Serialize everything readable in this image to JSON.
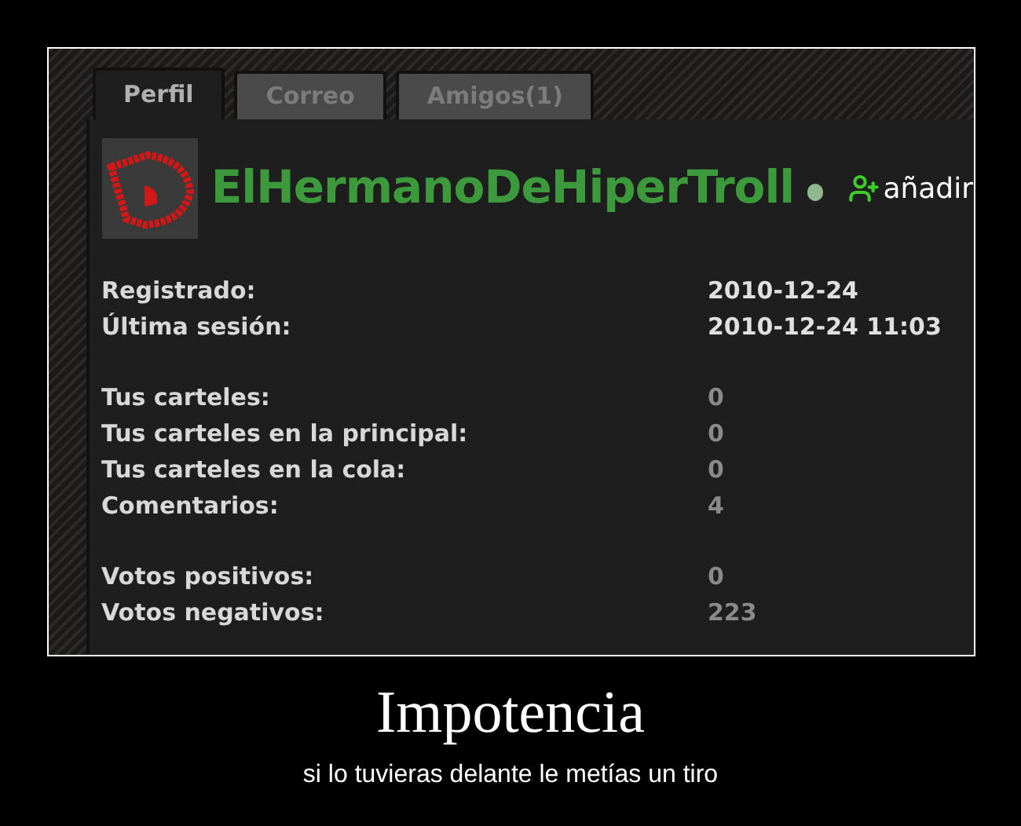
{
  "profile": {
    "tabs": [
      {
        "label": "Perfil",
        "selected": true
      },
      {
        "label": "Correo",
        "selected": false
      },
      {
        "label": "Amigos(1)",
        "selected": false
      }
    ],
    "user": {
      "name": "ElHermanoDeHiperTroll",
      "online": true,
      "add_link": "añadir"
    },
    "stat_groups": [
      [
        {
          "label": "Registrado:",
          "value": "2010-12-24",
          "kind": "date"
        },
        {
          "label": "Última sesión:",
          "value": "2010-12-24 11:03",
          "kind": "date"
        }
      ],
      [
        {
          "label": "Tus carteles:",
          "value": "0",
          "kind": "count"
        },
        {
          "label": "Tus carteles en la principal:",
          "value": "0",
          "kind": "count"
        },
        {
          "label": "Tus carteles en la cola:",
          "value": "0",
          "kind": "count"
        },
        {
          "label": "Comentarios:",
          "value": "4",
          "kind": "count"
        }
      ],
      [
        {
          "label": "Votos positivos:",
          "value": "0",
          "kind": "count"
        },
        {
          "label": "Votos negativos:",
          "value": "223",
          "kind": "count"
        }
      ]
    ]
  },
  "caption": {
    "title": "Impotencia",
    "subtitle": "si lo tuvieras delante le metías un tiro"
  }
}
